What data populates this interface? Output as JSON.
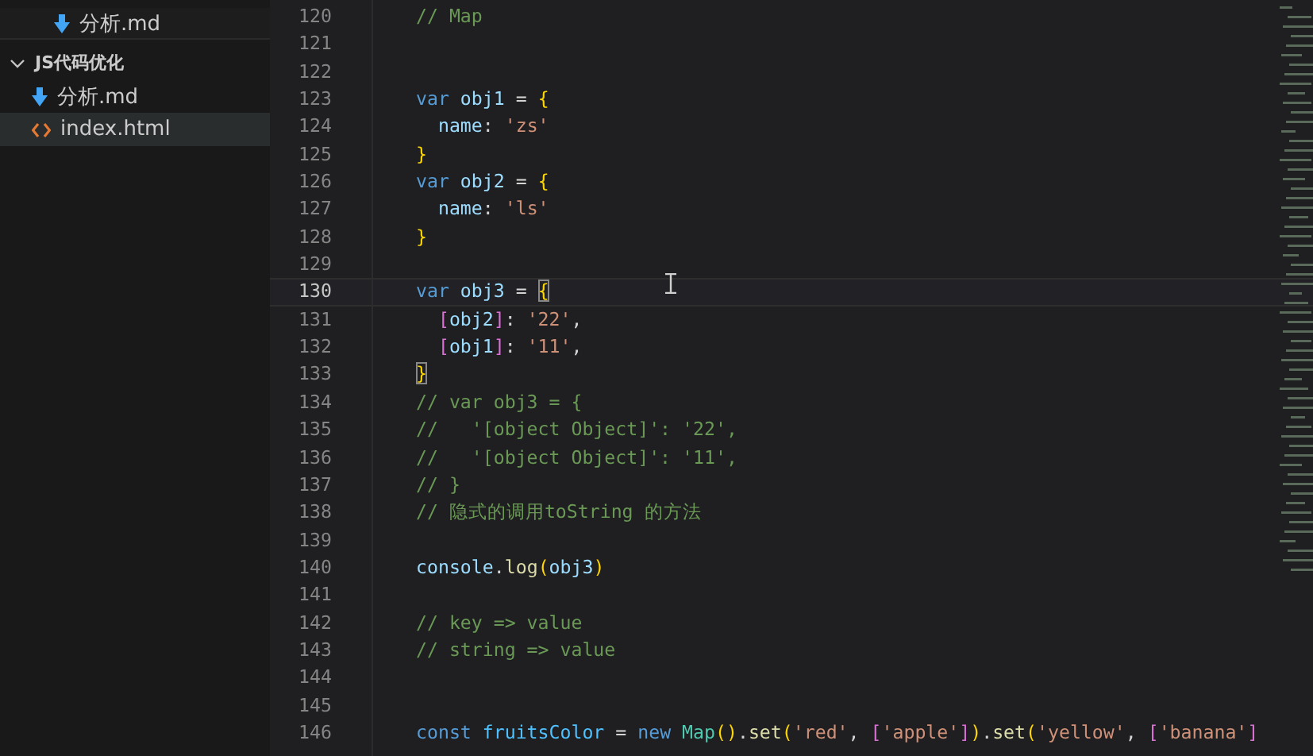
{
  "sidebar": {
    "items": [
      {
        "label": "分析.md",
        "kind": "markdown",
        "selected": false
      },
      {
        "label": "JS代码优化",
        "kind": "folder",
        "expanded": true,
        "selected": false,
        "children": [
          {
            "label": "分析.md",
            "kind": "markdown",
            "selected": false
          },
          {
            "label": "index.html",
            "kind": "html",
            "selected": true
          }
        ]
      }
    ]
  },
  "editor": {
    "lines": [
      {
        "number": "120",
        "active": false,
        "tokens": [
          {
            "kind": "comment",
            "text": "// Map"
          }
        ]
      },
      {
        "number": "121",
        "active": false
      },
      {
        "number": "122",
        "active": false
      },
      {
        "number": "123",
        "active": false,
        "tokens": [
          {
            "kind": "keyword",
            "text": "var"
          },
          {
            "kind": "variable",
            "text": " obj1"
          },
          {
            "kind": "plain",
            "text": " = "
          },
          {
            "kind": "brace",
            "text": "{"
          }
        ]
      },
      {
        "number": "124",
        "active": false,
        "tokens": [
          {
            "kind": "variable",
            "text": "  name"
          },
          {
            "kind": "plain",
            "text": ": "
          },
          {
            "kind": "string",
            "text": "'zs'"
          }
        ]
      },
      {
        "number": "125",
        "active": false,
        "tokens": [
          {
            "kind": "brace",
            "text": "}"
          }
        ]
      },
      {
        "number": "126",
        "active": false,
        "tokens": [
          {
            "kind": "keyword",
            "text": "var"
          },
          {
            "kind": "variable",
            "text": " obj2"
          },
          {
            "kind": "plain",
            "text": " = "
          },
          {
            "kind": "brace",
            "text": "{"
          }
        ]
      },
      {
        "number": "127",
        "active": false,
        "tokens": [
          {
            "kind": "variable",
            "text": "  name"
          },
          {
            "kind": "plain",
            "text": ": "
          },
          {
            "kind": "string",
            "text": "'ls'"
          }
        ]
      },
      {
        "number": "128",
        "active": false,
        "tokens": [
          {
            "kind": "brace",
            "text": "}"
          }
        ]
      },
      {
        "number": "129",
        "active": false
      },
      {
        "number": "130",
        "active": true,
        "tokens": [
          {
            "kind": "keyword",
            "text": "var"
          },
          {
            "kind": "variable",
            "text": " obj3"
          },
          {
            "kind": "plain",
            "text": " = "
          },
          {
            "kind": "brace-match",
            "text": "{"
          }
        ]
      },
      {
        "number": "131",
        "active": false,
        "tokens": [
          {
            "kind": "bracket",
            "text": "  ["
          },
          {
            "kind": "variable",
            "text": "obj2"
          },
          {
            "kind": "bracket",
            "text": "]"
          },
          {
            "kind": "plain",
            "text": ": "
          },
          {
            "kind": "string",
            "text": "'22'"
          },
          {
            "kind": "plain",
            "text": ","
          }
        ]
      },
      {
        "number": "132",
        "active": false,
        "tokens": [
          {
            "kind": "bracket",
            "text": "  ["
          },
          {
            "kind": "variable",
            "text": "obj1"
          },
          {
            "kind": "bracket",
            "text": "]"
          },
          {
            "kind": "plain",
            "text": ": "
          },
          {
            "kind": "string",
            "text": "'11'"
          },
          {
            "kind": "plain",
            "text": ","
          }
        ]
      },
      {
        "number": "133",
        "active": false,
        "tokens": [
          {
            "kind": "brace-match",
            "text": "}"
          }
        ]
      },
      {
        "number": "134",
        "active": false,
        "tokens": [
          {
            "kind": "comment",
            "text": "// var obj3 = {"
          }
        ]
      },
      {
        "number": "135",
        "active": false,
        "tokens": [
          {
            "kind": "comment",
            "text": "//   '[object Object]': '22',"
          }
        ]
      },
      {
        "number": "136",
        "active": false,
        "tokens": [
          {
            "kind": "comment",
            "text": "//   '[object Object]': '11',"
          }
        ]
      },
      {
        "number": "137",
        "active": false,
        "tokens": [
          {
            "kind": "comment",
            "text": "// }"
          }
        ]
      },
      {
        "number": "138",
        "active": false,
        "tokens": [
          {
            "kind": "comment",
            "text": "// 隐式的调用toString 的方法"
          }
        ]
      },
      {
        "number": "139",
        "active": false
      },
      {
        "number": "140",
        "active": false,
        "tokens": [
          {
            "kind": "variable",
            "text": "console"
          },
          {
            "kind": "plain",
            "text": "."
          },
          {
            "kind": "function",
            "text": "log"
          },
          {
            "kind": "brace",
            "text": "("
          },
          {
            "kind": "variable",
            "text": "obj3"
          },
          {
            "kind": "brace",
            "text": ")"
          }
        ]
      },
      {
        "number": "141",
        "active": false
      },
      {
        "number": "142",
        "active": false,
        "tokens": [
          {
            "kind": "comment",
            "text": "// key => value"
          }
        ]
      },
      {
        "number": "143",
        "active": false,
        "tokens": [
          {
            "kind": "comment",
            "text": "// string => value"
          }
        ]
      },
      {
        "number": "144",
        "active": false
      },
      {
        "number": "145",
        "active": false
      },
      {
        "number": "146",
        "active": false,
        "tokens": [
          {
            "kind": "keyword",
            "text": "const"
          },
          {
            "kind": "constant",
            "text": " fruitsColor"
          },
          {
            "kind": "plain",
            "text": " = "
          },
          {
            "kind": "keyword",
            "text": "new"
          },
          {
            "kind": "class",
            "text": " Map"
          },
          {
            "kind": "brace",
            "text": "()"
          },
          {
            "kind": "plain",
            "text": "."
          },
          {
            "kind": "function",
            "text": "set"
          },
          {
            "kind": "brace",
            "text": "("
          },
          {
            "kind": "string",
            "text": "'red'"
          },
          {
            "kind": "plain",
            "text": ", "
          },
          {
            "kind": "bracket",
            "text": "["
          },
          {
            "kind": "string",
            "text": "'apple'"
          },
          {
            "kind": "bracket",
            "text": "]"
          },
          {
            "kind": "brace",
            "text": ")"
          },
          {
            "kind": "plain",
            "text": "."
          },
          {
            "kind": "function",
            "text": "set"
          },
          {
            "kind": "brace",
            "text": "("
          },
          {
            "kind": "string",
            "text": "'yellow'"
          },
          {
            "kind": "plain",
            "text": ", "
          },
          {
            "kind": "bracket",
            "text": "["
          },
          {
            "kind": "string",
            "text": "'banana'"
          },
          {
            "kind": "bracket",
            "text": "]"
          }
        ]
      }
    ]
  }
}
